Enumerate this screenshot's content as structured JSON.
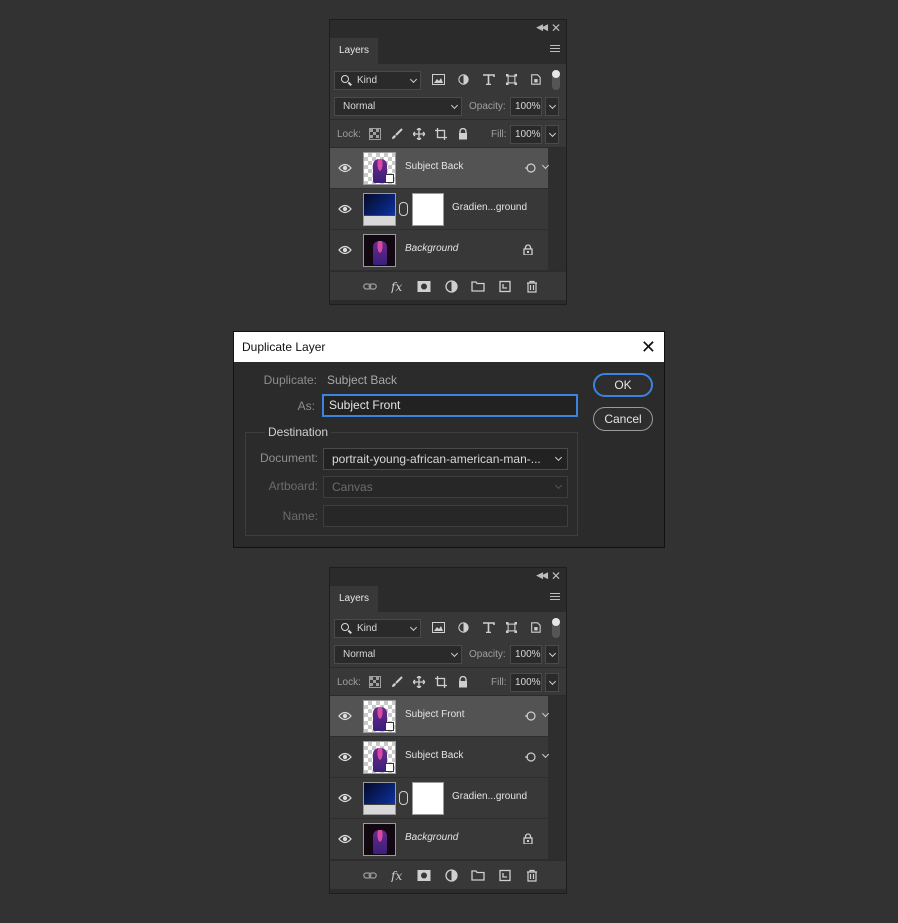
{
  "panel_top": {
    "tab_label": "Layers",
    "filter_kind": "Kind",
    "blend_mode": "Normal",
    "opacity_label": "Opacity:",
    "opacity_value": "100%",
    "lock_label": "Lock:",
    "fill_label": "Fill:",
    "fill_value": "100%",
    "layers": [
      {
        "name": "Subject Back"
      },
      {
        "name": "Gradien...ground"
      },
      {
        "name": "Background"
      }
    ]
  },
  "dialog": {
    "title": "Duplicate Layer",
    "duplicate_label": "Duplicate:",
    "duplicate_value": "Subject Back",
    "as_label": "As:",
    "as_value": "Subject Front",
    "ok_label": "OK",
    "cancel_label": "Cancel",
    "destination_label": "Destination",
    "document_label": "Document:",
    "document_value": "portrait-young-african-american-man-...",
    "artboard_label": "Artboard:",
    "artboard_value": "Canvas",
    "name_label": "Name:",
    "name_value": ""
  },
  "panel_bottom": {
    "tab_label": "Layers",
    "filter_kind": "Kind",
    "blend_mode": "Normal",
    "opacity_label": "Opacity:",
    "opacity_value": "100%",
    "lock_label": "Lock:",
    "fill_label": "Fill:",
    "fill_value": "100%",
    "layers": [
      {
        "name": "Subject Front"
      },
      {
        "name": "Subject Back"
      },
      {
        "name": "Gradien...ground"
      },
      {
        "name": "Background"
      }
    ]
  },
  "colors": {
    "accent": "#3b83e0",
    "panel_bg": "#383838",
    "selected_layer": "#535353",
    "page_bg": "#323232"
  }
}
